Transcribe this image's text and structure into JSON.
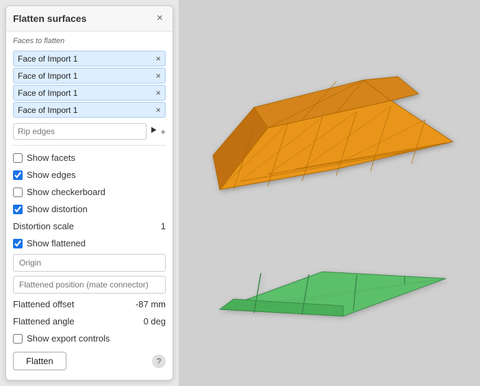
{
  "panel": {
    "title": "Flatten surfaces",
    "close_label": "×",
    "faces_section_label": "Faces to flatten",
    "faces": [
      {
        "label": "Face of Import 1",
        "id": 1
      },
      {
        "label": "Face of Import 1",
        "id": 2
      },
      {
        "label": "Face of Import 1",
        "id": 3
      },
      {
        "label": "Face of Import 1",
        "id": 4
      }
    ],
    "rip_edges_placeholder": "Rip edges",
    "checkboxes": [
      {
        "id": "show-facets",
        "label": "Show facets",
        "checked": false
      },
      {
        "id": "show-edges",
        "label": "Show edges",
        "checked": true
      },
      {
        "id": "show-checkerboard",
        "label": "Show checkerboard",
        "checked": false
      },
      {
        "id": "show-distortion",
        "label": "Show distortion",
        "checked": true
      },
      {
        "id": "show-flattened",
        "label": "Show flattened",
        "checked": true
      }
    ],
    "distortion_scale_label": "Distortion scale",
    "distortion_scale_value": "1",
    "origin_placeholder": "Origin",
    "flattened_position_placeholder": "Flattened position (mate connector)",
    "flattened_offset_label": "Flattened offset",
    "flattened_offset_value": "-87 mm",
    "flattened_angle_label": "Flattened angle",
    "flattened_angle_value": "0 deg",
    "show_export_controls_label": "Show export controls",
    "show_export_controls_checked": false,
    "flatten_button_label": "Flatten",
    "help_icon_label": "?"
  },
  "colors": {
    "mesh_orange": "#E8951A",
    "mesh_dark_orange": "#B06A00",
    "flat_green": "#5CBF6A",
    "flat_dark_green": "#3A8A48",
    "face_bg": "#cce4f7",
    "face_border": "#88b8d8"
  }
}
